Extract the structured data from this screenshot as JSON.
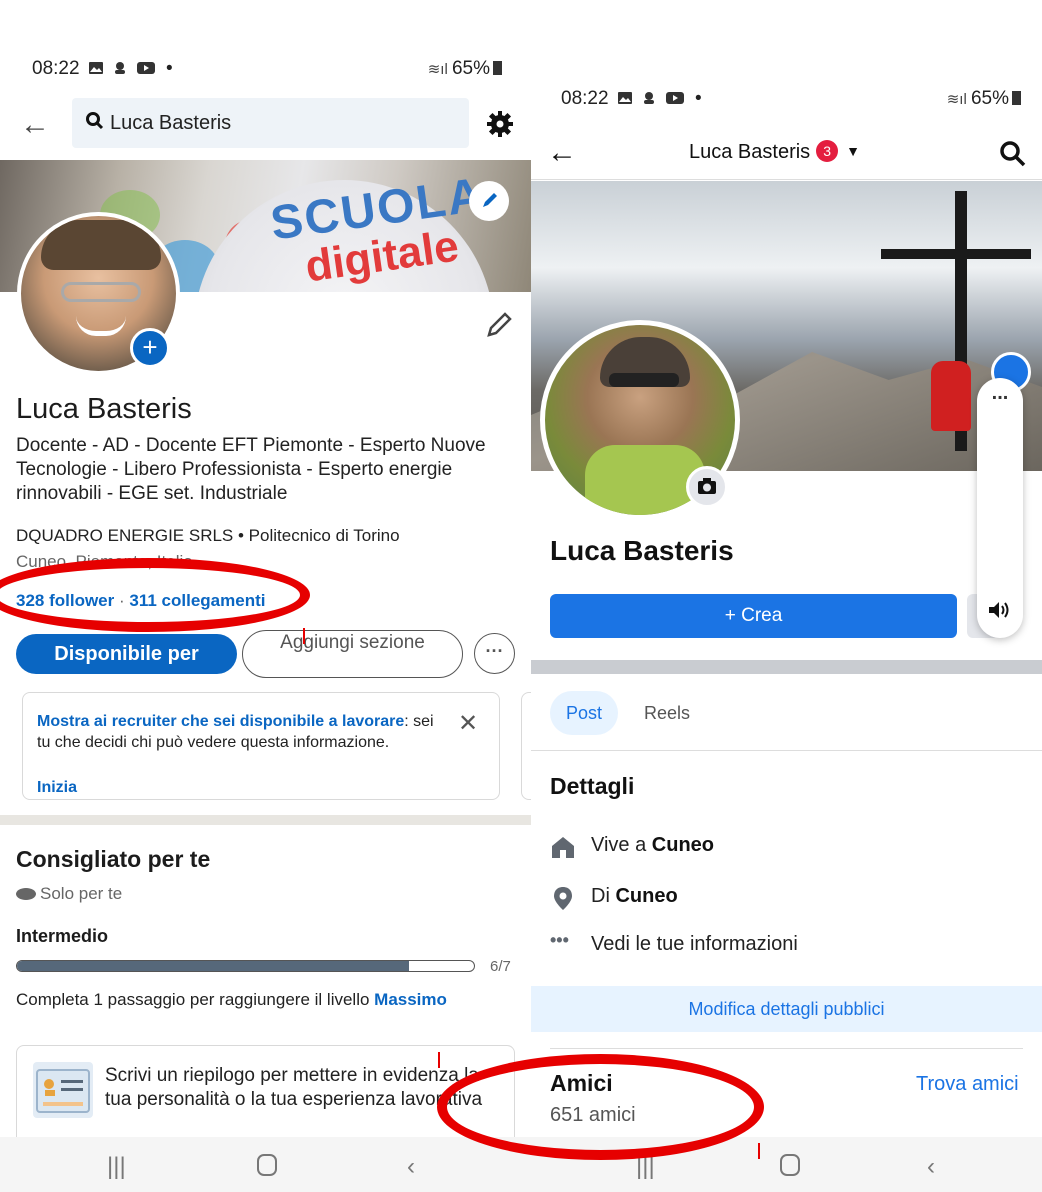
{
  "left": {
    "status": {
      "time": "08:22",
      "battery": "65%"
    },
    "search": {
      "value": "Luca Basteris"
    },
    "cover": {
      "line1": "SCUOLA",
      "line2": "digitale"
    },
    "profile": {
      "name": "Luca Basteris",
      "headline": "Docente - AD - Docente EFT Piemonte - Esperto Nuove Tecnologie - Libero Professionista - Esperto energie rinnovabili - EGE set. Industriale",
      "work": "DQUADRO ENERGIE SRLS • Politecnico di Torino",
      "location": "Cuneo, Piemonte, Italia",
      "followers": "328 follower",
      "separator": "·",
      "connections": "311 collegamenti"
    },
    "buttons": {
      "available": "Disponibile per",
      "add_section": "Aggiungi sezione",
      "more": "···"
    },
    "opentowork": {
      "bold_text": "Mostra ai recruiter che sei disponibile a lavorare",
      "text": ": sei tu che decidi chi può vedere questa informazione.",
      "link": "Inizia",
      "close": "✕"
    },
    "recommended": {
      "title": "Consigliato per te",
      "subtitle": "Solo per te",
      "level": "Intermedio",
      "progress": 0.857,
      "progress_label": "6/7",
      "complete_text": "Completa 1 passaggio per raggiungere il livello ",
      "complete_level": "Massimo",
      "tip": "Scrivi un riepilogo per mettere in evidenza la tua personalità o la tua esperienza lavorativa"
    }
  },
  "right": {
    "status": {
      "time": "08:22",
      "battery": "65%"
    },
    "header": {
      "title": "Luca Basteris",
      "badge_count": "3"
    },
    "profile": {
      "name": "Luca Basteris"
    },
    "buttons": {
      "create": "+ Crea",
      "modify": "Modifica dettagli pubblici"
    },
    "tabs": [
      {
        "label": "Post"
      },
      {
        "label": "Reels"
      }
    ],
    "details": {
      "title": "Dettagli",
      "lives_prefix": "Vive a ",
      "lives_city": "Cuneo",
      "from_prefix": "Di ",
      "from_city": "Cuneo",
      "info": "Vedi le tue informazioni"
    },
    "friends": {
      "title": "Amici",
      "count": "651 amici",
      "find": "Trova amici"
    }
  }
}
